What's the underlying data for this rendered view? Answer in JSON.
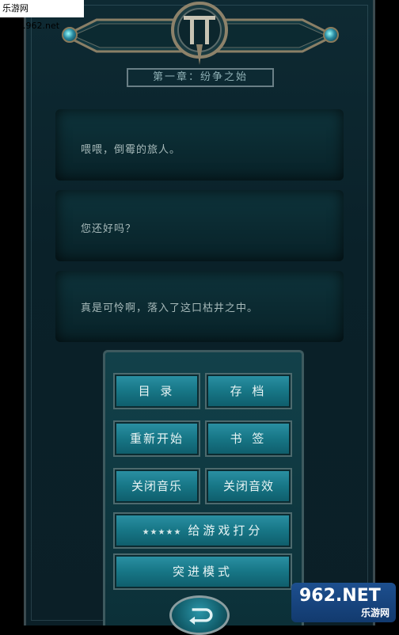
{
  "watermark_top": "乐游网 www.962.net",
  "chapter_title": "第一章：纷争之始",
  "dialogs": [
    "喂喂，倒霉的旅人。",
    "您还好吗？",
    "真是可怜啊，落入了这口枯井之中。"
  ],
  "menu": {
    "catalog": "目 录",
    "save": "存 档",
    "restart": "重新开始",
    "bookmark": "书 签",
    "music_off": "关闭音乐",
    "sfx_off": "关闭音效",
    "rate_stars": "★★★★★",
    "rate": "给游戏打分",
    "breakthrough": "突进模式"
  },
  "watermark_br": {
    "brand": "962.NET",
    "sub": "乐游网"
  }
}
